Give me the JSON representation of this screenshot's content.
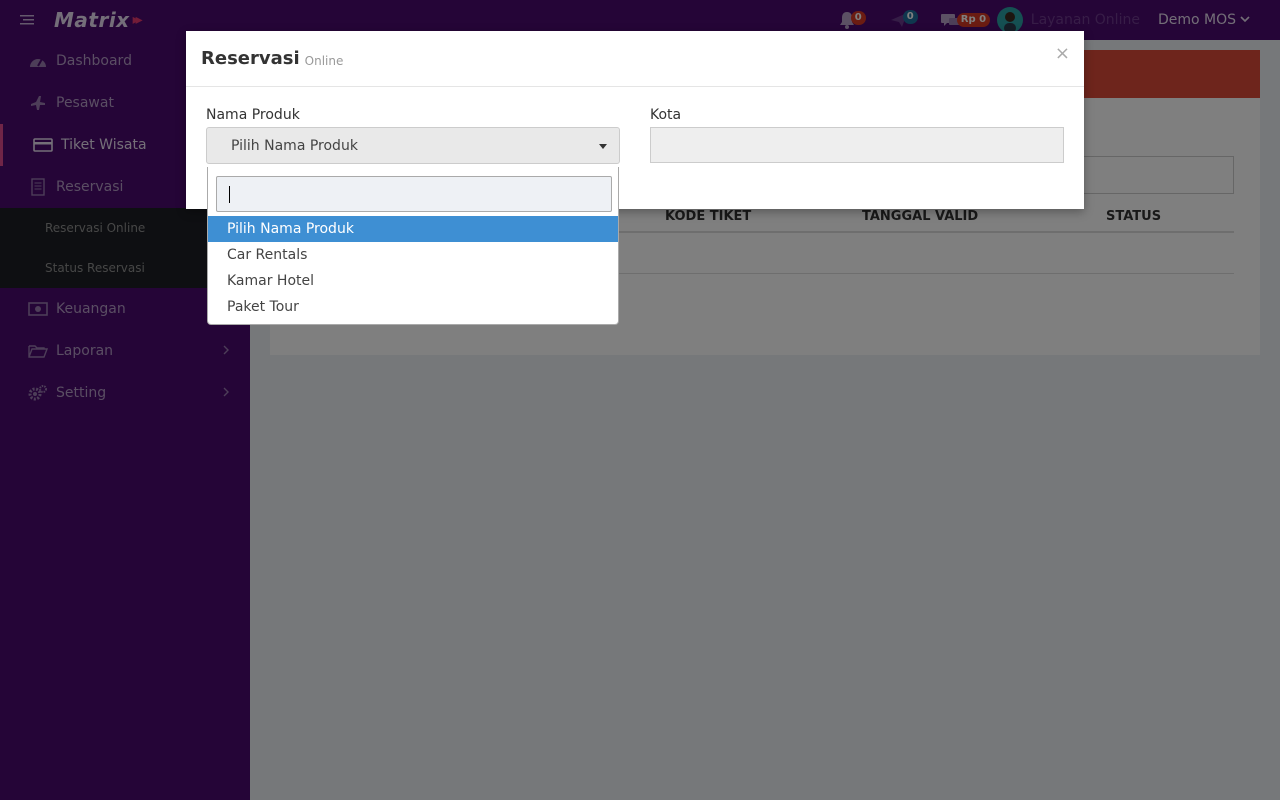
{
  "header": {
    "logo_text": "Matrix",
    "logo_arrows": "▸▸",
    "notifications_count": "0",
    "messages_count": "0",
    "balance": "Rp 0",
    "layanan_label": "Layanan Online",
    "user_label": "Demo MOS"
  },
  "sidebar": {
    "items": [
      {
        "label": "Dashboard",
        "icon": "dashboard-icon"
      },
      {
        "label": "Pesawat",
        "icon": "plane-icon"
      },
      {
        "label": "Tiket Wisata",
        "icon": "card-icon"
      },
      {
        "label": "Reservasi",
        "icon": "document-icon"
      },
      {
        "label": "Keuangan",
        "icon": "money-icon"
      },
      {
        "label": "Laporan",
        "icon": "folder-icon"
      },
      {
        "label": "Setting",
        "icon": "gears-icon"
      }
    ],
    "submenu": [
      {
        "label": "Reservasi Online"
      },
      {
        "label": "Status Reservasi"
      }
    ]
  },
  "table": {
    "columns": [
      "KODE TIKET",
      "TANGGAL VALID",
      "STATUS"
    ]
  },
  "modal": {
    "title": "Reservasi",
    "subtitle": "Online",
    "close_symbol": "×",
    "nama_produk_label": "Nama Produk",
    "nama_produk_value": "Pilih Nama Produk",
    "kota_label": "Kota",
    "kota_value": ""
  },
  "dropdown": {
    "search_value": "",
    "options": [
      {
        "label": "Pilih Nama Produk",
        "selected": true
      },
      {
        "label": "Car Rentals",
        "selected": false
      },
      {
        "label": "Kamar Hotel",
        "selected": false
      },
      {
        "label": "Paket Tour",
        "selected": false
      }
    ]
  },
  "colors": {
    "sidebar_bg": "#4a0a6e",
    "accent_red": "#dd4b39",
    "selected_option": "#3e8fd3"
  }
}
